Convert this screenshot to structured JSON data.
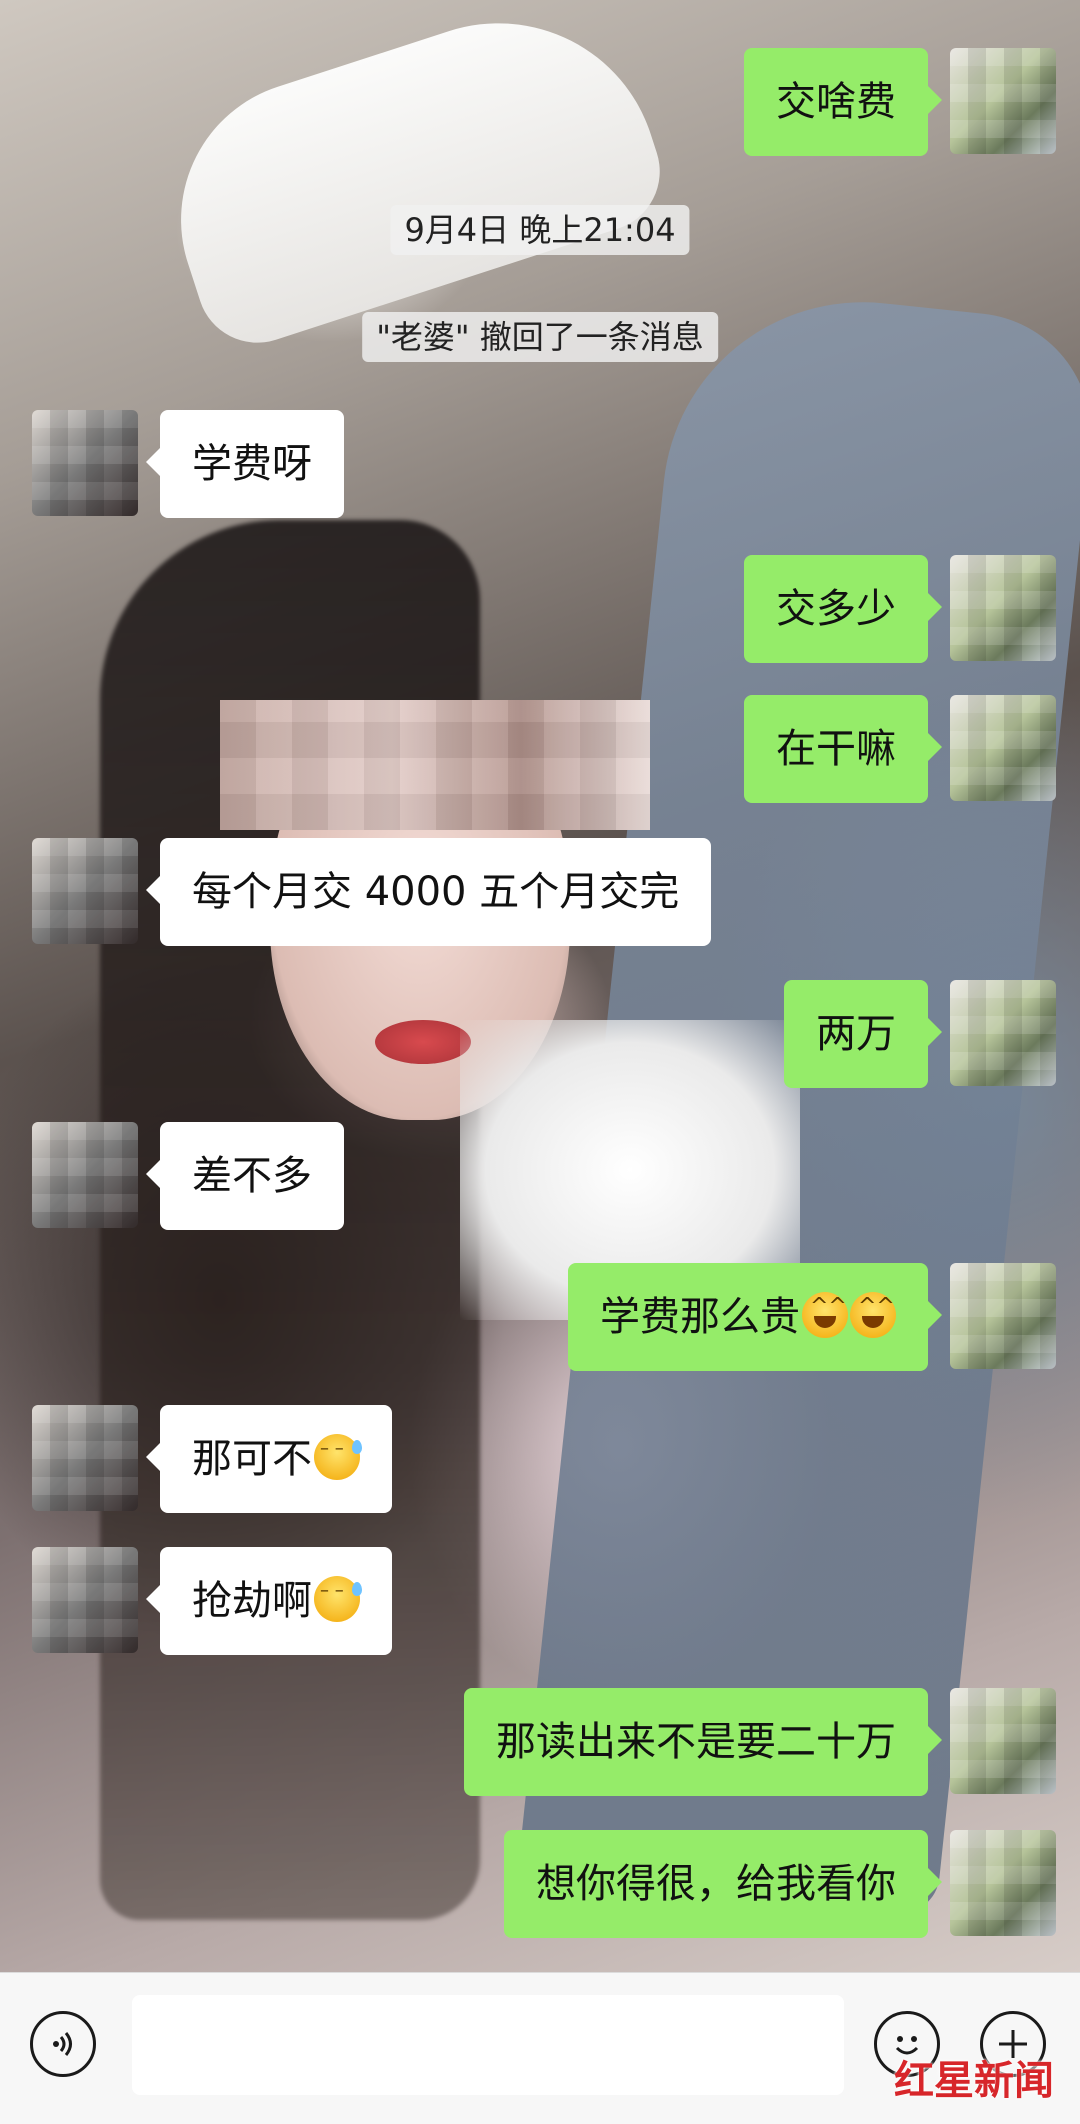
{
  "chat": {
    "timestamp": "9月4日 晚上21:04",
    "recall_notice": "\"老婆\" 撤回了一条消息",
    "messages": [
      {
        "side": "right",
        "text": "交啥费"
      },
      {
        "side": "left",
        "text": "学费呀"
      },
      {
        "side": "right",
        "text": "交多少"
      },
      {
        "side": "right",
        "text": "在干嘛"
      },
      {
        "side": "left",
        "text": "每个月交 4000 五个月交完"
      },
      {
        "side": "right",
        "text": "两万"
      },
      {
        "side": "left",
        "text": "差不多"
      },
      {
        "side": "right",
        "text": "学费那么贵",
        "emojis": [
          "laugh-cry-emoji",
          "laugh-cry-emoji"
        ]
      },
      {
        "side": "left",
        "text": "那可不",
        "emojis": [
          "sweat-emoji"
        ]
      },
      {
        "side": "left",
        "text": "抢劫啊",
        "emojis": [
          "sweat-emoji"
        ]
      },
      {
        "side": "right",
        "text": "那读出来不是要二十万"
      },
      {
        "side": "right",
        "text": "想你得很，给我看你"
      }
    ]
  },
  "colors": {
    "outgoing_bubble": "#95ec69",
    "incoming_bubble": "#ffffff",
    "watermark": "#d7262a"
  },
  "input_bar": {
    "voice_icon": "voice-icon",
    "emoji_icon": "smiley-icon",
    "plus_icon": "plus-icon",
    "input_value": ""
  },
  "watermark": {
    "text": "红星新闻"
  }
}
